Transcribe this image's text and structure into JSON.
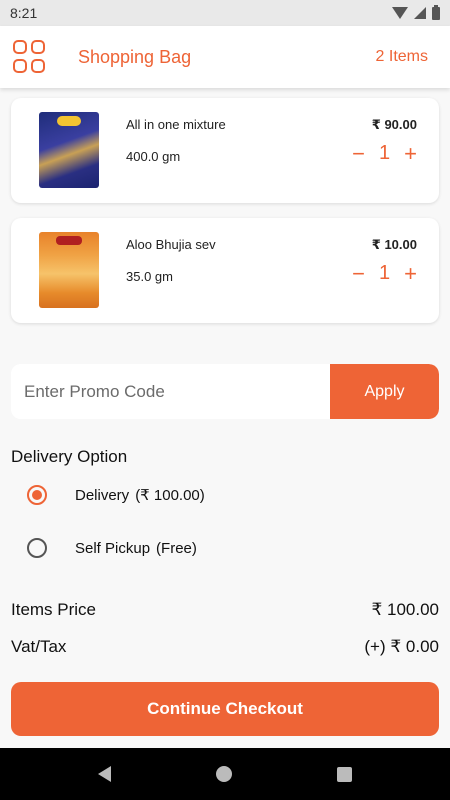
{
  "status_bar": {
    "time": "8:21"
  },
  "header": {
    "title": "Shopping Bag",
    "item_count": "2 Items"
  },
  "cart": {
    "items": [
      {
        "name": "All in one mixture",
        "weight": "400.0 gm",
        "price": "₹ 90.00",
        "quantity": "1",
        "decrement": "−",
        "increment": "+"
      },
      {
        "name": "Aloo Bhujia sev",
        "weight": "35.0 gm",
        "price": "₹ 10.00",
        "quantity": "1",
        "decrement": "−",
        "increment": "+"
      }
    ]
  },
  "promo": {
    "placeholder": "Enter Promo Code",
    "apply_label": "Apply"
  },
  "delivery": {
    "title": "Delivery Option",
    "options": [
      {
        "label": "Delivery",
        "detail": "(₹ 100.00)",
        "selected": true
      },
      {
        "label": "Self Pickup",
        "detail": "(Free)",
        "selected": false
      }
    ]
  },
  "summary": {
    "items_price_label": "Items Price",
    "items_price_value": "₹ 100.00",
    "vat_label": "Vat/Tax",
    "vat_value": "(+) ₹ 0.00"
  },
  "checkout": {
    "label": "Continue Checkout"
  },
  "colors": {
    "accent": "#ee6436",
    "background": "#f8f8f8",
    "card": "#ffffff"
  }
}
